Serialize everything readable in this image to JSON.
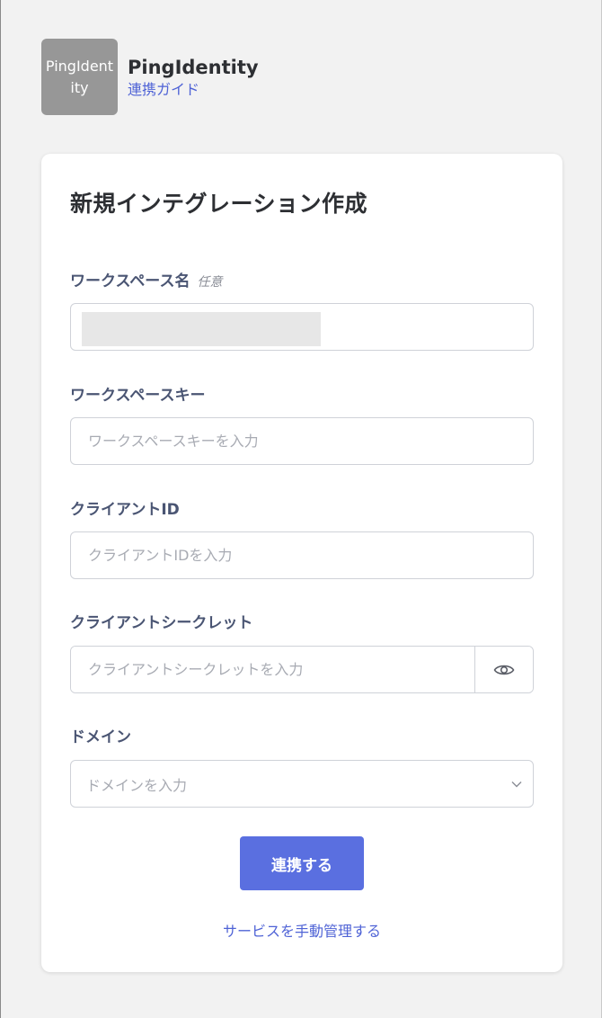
{
  "header": {
    "logo_text": "PingIdentity",
    "brand_name": "PingIdentity",
    "guide_link": "連携ガイド"
  },
  "form": {
    "title": "新規インテグレーション作成",
    "workspace_name": {
      "label": "ワークスペース名",
      "optional": "任意"
    },
    "workspace_key": {
      "label": "ワークスペースキー",
      "placeholder": "ワークスペースキーを入力"
    },
    "client_id": {
      "label": "クライアントID",
      "placeholder": "クライアントIDを入力"
    },
    "client_secret": {
      "label": "クライアントシークレット",
      "placeholder": "クライアントシークレットを入力"
    },
    "domain": {
      "label": "ドメイン",
      "placeholder": "ドメインを入力"
    },
    "submit_label": "連携する",
    "manual_link": "サービスを手動管理する"
  },
  "colors": {
    "accent": "#5a6fe0",
    "link": "#4f63d6",
    "label": "#4a5573"
  }
}
